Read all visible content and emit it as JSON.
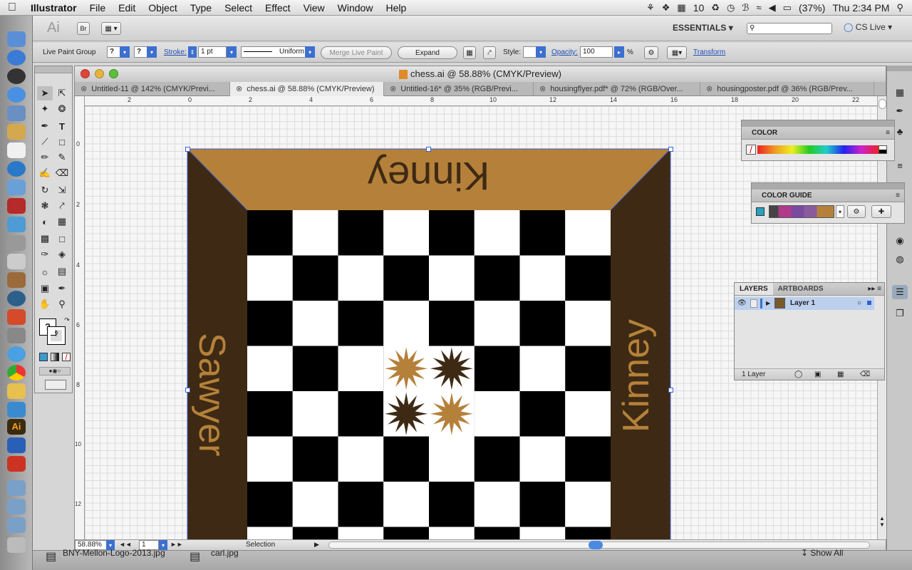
{
  "menubar": {
    "app_name": "Illustrator",
    "menus": [
      "File",
      "Edit",
      "Object",
      "Type",
      "Select",
      "Effect",
      "View",
      "Window",
      "Help"
    ],
    "status": {
      "badge_count": "10",
      "battery": "(37%)",
      "clock": "Thu 2:34 PM"
    }
  },
  "appbar": {
    "ai_logo": "Ai",
    "br_button": "Br",
    "workspace": "ESSENTIALS",
    "search_placeholder": "",
    "cs_live": "CS Live"
  },
  "control": {
    "selection_label": "Live Paint Group",
    "stroke_label": "Stroke:",
    "stroke_value": "1 pt",
    "profile": "Uniform",
    "merge_live_paint": "Merge Live Paint",
    "expand": "Expand",
    "style_label": "Style:",
    "opacity_label": "Opacity:",
    "opacity_value": "100",
    "percent": "%",
    "transform": "Transform",
    "question": "?"
  },
  "document": {
    "title": "chess.ai @ 58.88% (CMYK/Preview)",
    "tabs": [
      "Untitled-11 @ 142% (CMYK/Previ...",
      "chess.ai @ 58.88% (CMYK/Preview)",
      "Untitled-16* @ 35% (RGB/Previ...",
      "housingflyer.pdf* @ 72% (RGB/Over...",
      "housingposter.pdf @ 36% (RGB/Prev..."
    ],
    "active_tab": 1,
    "hruler_labels": [
      "2",
      "0",
      "2",
      "4",
      "6",
      "8",
      "10",
      "12",
      "14",
      "16",
      "18",
      "20",
      "22"
    ],
    "vruler_labels": [
      "0",
      "2",
      "4",
      "6",
      "8",
      "10",
      "12"
    ],
    "zoom": "58.88%",
    "artboard": "1",
    "status_tool": "Selection"
  },
  "artwork": {
    "top_name": "Kinney",
    "left_name": "Sawyer",
    "right_name": "Kinney",
    "colors": {
      "gold": "#b5813a",
      "dark_brown": "#3e2a14",
      "black": "#000000",
      "white": "#ffffff",
      "selection": "#3a5fd0"
    }
  },
  "panels": {
    "color": {
      "title": "COLOR"
    },
    "color_guide": {
      "title": "COLOR GUIDE"
    },
    "layers": {
      "tab1": "LAYERS",
      "tab2": "ARTBOARDS",
      "layer_name": "Layer 1",
      "count": "1 Layer"
    }
  },
  "bottombar": {
    "file1": "BNY-Mellon-Logo-2013.jpg",
    "file2": "carl.jpg",
    "show_all": "Show All"
  }
}
